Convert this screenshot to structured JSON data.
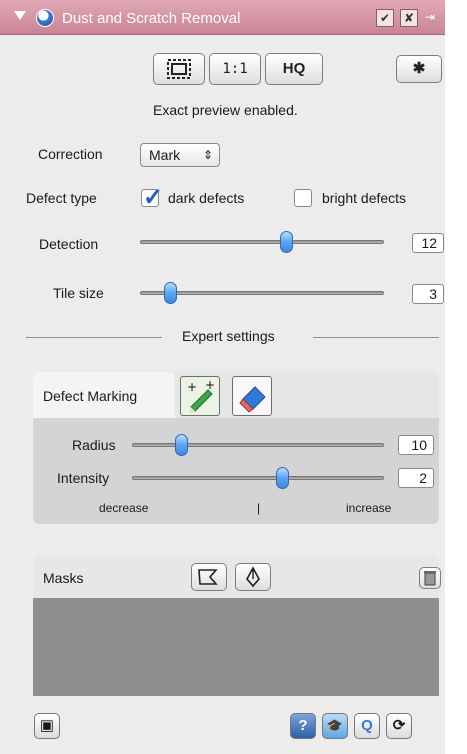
{
  "titlebar": {
    "title": "Dust and Scratch Removal",
    "btn_check": "✔",
    "btn_close": "✘",
    "btn_pin": "⇥"
  },
  "preview": {
    "btn_fit": "[  ]",
    "btn_1to1": "1:1",
    "btn_hq": "HQ",
    "gear_glyph": "✱",
    "status": "Exact preview enabled."
  },
  "correction": {
    "label": "Correction",
    "selected": "Mark",
    "arrows": "⇕"
  },
  "defect_type": {
    "label": "Defect type",
    "dark_label": "dark defects",
    "dark_checked": true,
    "bright_label": "bright defects",
    "bright_checked": false
  },
  "detection": {
    "label": "Detection",
    "value": "12",
    "fraction": 0.6
  },
  "tile_size": {
    "label": "Tile size",
    "value": "3",
    "fraction": 0.12
  },
  "expert": {
    "title": "Expert settings"
  },
  "defect_marking": {
    "tab_label": "Defect Marking",
    "radius": {
      "label": "Radius",
      "value": "10",
      "fraction": 0.19
    },
    "intensity": {
      "label": "Intensity",
      "value": "2",
      "fraction": 0.6
    },
    "decrease_label": "decrease",
    "center_mark": "|",
    "increase_label": "increase"
  },
  "masks": {
    "label": "Masks"
  },
  "bottom": {
    "save_glyph": "▣",
    "help_glyph": "?",
    "learn_glyph": "🎓",
    "q_glyph": "Q",
    "refresh_glyph": "⟳"
  },
  "colors": {
    "titlebar": "#d395a6",
    "accent_blue": "#3e86e0"
  }
}
